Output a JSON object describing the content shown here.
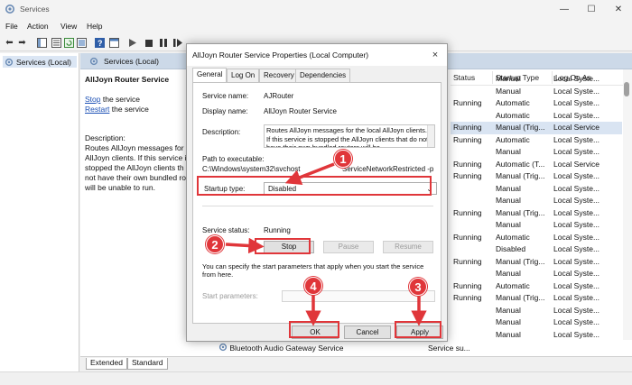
{
  "window": {
    "title": "Services"
  },
  "menu": [
    "File",
    "Action",
    "View",
    "Help"
  ],
  "tree": {
    "item": "Services (Local)"
  },
  "pane": {
    "header": "Services (Local)",
    "service_name": "AllJoyn Router Service",
    "stop_link": "Stop",
    "stop_rest": " the service",
    "restart_link": "Restart",
    "restart_rest": " the service",
    "description_label": "Description:",
    "description_lines": [
      "Routes AllJoyn messages for t",
      "AllJoyn clients. If this service i",
      "stopped the AllJoyn clients th",
      "not have their own bundled ro",
      "will be unable to run."
    ]
  },
  "columns": {
    "status": "Status",
    "startup_type": "Startup Type",
    "log_on_as": "Log On As"
  },
  "rows": [
    {
      "status": "",
      "startup": "Manual",
      "logon": "Local Syste..."
    },
    {
      "status": "",
      "startup": "Manual",
      "logon": "Local Syste..."
    },
    {
      "status": "Running",
      "startup": "Automatic",
      "logon": "Local Syste..."
    },
    {
      "status": "",
      "startup": "Automatic",
      "logon": "Local Syste..."
    },
    {
      "status": "Running",
      "startup": "Manual (Trig...",
      "logon": "Local Service",
      "selected": true
    },
    {
      "status": "Running",
      "startup": "Automatic",
      "logon": "Local Syste..."
    },
    {
      "status": "",
      "startup": "Manual",
      "logon": "Local Syste..."
    },
    {
      "status": "Running",
      "startup": "Automatic (T...",
      "logon": "Local Service"
    },
    {
      "status": "Running",
      "startup": "Manual (Trig...",
      "logon": "Local Syste..."
    },
    {
      "status": "",
      "startup": "Manual",
      "logon": "Local Syste..."
    },
    {
      "status": "",
      "startup": "Manual",
      "logon": "Local Syste..."
    },
    {
      "status": "Running",
      "startup": "Manual (Trig...",
      "logon": "Local Syste..."
    },
    {
      "status": "",
      "startup": "Manual",
      "logon": "Local Syste..."
    },
    {
      "status": "Running",
      "startup": "Automatic",
      "logon": "Local Syste..."
    },
    {
      "status": "",
      "startup": "Disabled",
      "logon": "Local Syste..."
    },
    {
      "status": "Running",
      "startup": "Manual (Trig...",
      "logon": "Local Syste..."
    },
    {
      "status": "",
      "startup": "Manual",
      "logon": "Local Syste..."
    },
    {
      "status": "Running",
      "startup": "Automatic",
      "logon": "Local Syste..."
    },
    {
      "status": "Running",
      "startup": "Manual (Trig...",
      "logon": "Local Syste..."
    },
    {
      "status": "",
      "startup": "Manual",
      "logon": "Local Syste..."
    },
    {
      "status": "",
      "startup": "Manual",
      "logon": "Local Syste..."
    },
    {
      "status": "",
      "startup": "Manual",
      "logon": "Local Syste..."
    }
  ],
  "bottom_row": {
    "name": "Bluetooth Audio Gateway Service",
    "description": "Service su..."
  },
  "bottom_tabs": [
    "Extended",
    "Standard"
  ],
  "dialog": {
    "title": "AllJoyn Router Service Properties (Local Computer)",
    "close": "×",
    "tabs": [
      "General",
      "Log On",
      "Recovery",
      "Dependencies"
    ],
    "service_name_label": "Service name:",
    "service_name": "AJRouter",
    "display_name_label": "Display name:",
    "display_name": "AllJoyn Router Service",
    "description_label": "Description:",
    "description": "Routes AllJoyn messages for the local AllJoyn clients. If this service is stopped the AllJoyn clients that do not have their own bundled routers will be",
    "path_label": "Path to executable:",
    "path_start": "C:\\Windows\\system32\\svchost",
    "path_end": "ServiceNetworkRestricted -p",
    "startup_type_label": "Startup type:",
    "startup_type_value": "Disabled",
    "service_status_label": "Service status:",
    "service_status": "Running",
    "stop": "Stop",
    "pause": "Pause",
    "resume": "Resume",
    "hint_line1": "You can specify the start parameters that apply when you start the service",
    "hint_line2": "from here.",
    "start_params_label": "Start parameters:",
    "ok": "OK",
    "cancel": "Cancel",
    "apply": "Apply"
  },
  "annotations": [
    "1",
    "2",
    "3",
    "4"
  ],
  "colors": {
    "annotation_red": "#e0363a",
    "selection": "#d9e4f2",
    "pane_header": "#ccd9e8",
    "link": "#1a4fb5"
  }
}
